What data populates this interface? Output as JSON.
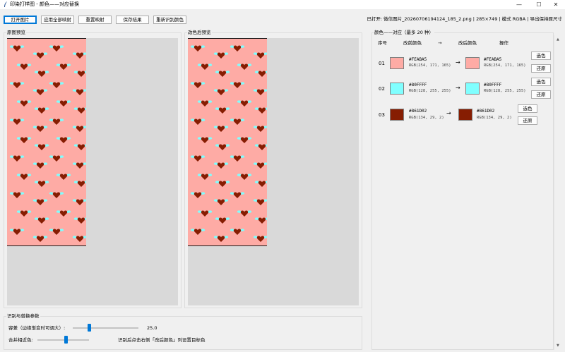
{
  "window": {
    "title": "印染打样图 - 颜色——对应替换",
    "minimize": "—",
    "maximize": "☐",
    "close": "✕"
  },
  "toolbar": {
    "open": "打开图片",
    "apply_all": "应用全部映射",
    "reset_map": "重置映射",
    "save": "保存结果",
    "redetect": "重新识别颜色",
    "file_info": "已打开: 微信图片_20260706194124_185_2.png  |  285×749  |  模式 RGBA  |  导出保持原尺寸"
  },
  "preview": {
    "original_title": "原图预览",
    "modified_title": "改色后预览"
  },
  "mapping": {
    "title": "颜色——对应（最多 20 种）",
    "headers": {
      "index": "序号",
      "before": "改前颜色",
      "arrow": "→",
      "after": "改后颜色",
      "action": "操作"
    },
    "rows": [
      {
        "index": "01",
        "before_hex": "#FEABA5",
        "before_rgb": "RGB(254, 171, 165)",
        "after_hex": "#FEABA5",
        "after_rgb": "RGB(254, 171, 165)",
        "arrow": "→",
        "pick": "选色",
        "restore": "还原"
      },
      {
        "index": "02",
        "before_hex": "#80FFFF",
        "before_rgb": "RGB(128, 255, 255)",
        "after_hex": "#80FFFF",
        "after_rgb": "RGB(128, 255, 255)",
        "arrow": "→",
        "pick": "选色",
        "restore": "还原"
      },
      {
        "index": "03",
        "before_hex": "#861D02",
        "before_rgb": "RGB(134, 29, 2)",
        "after_hex": "#861D02",
        "after_rgb": "RGB(134, 29, 2)",
        "arrow": "→",
        "pick": "选色",
        "restore": "还原"
      }
    ]
  },
  "params": {
    "title": "识别与替换参数",
    "tolerance_label": "容差（边缘渐变时可调大）:",
    "tolerance_value": "25.0",
    "tolerance_fraction": 0.25,
    "merge_label": "合并相近色:",
    "merge_fraction": 0.55,
    "hint": "识别后点击右侧「改后颜色」列设置目标色"
  },
  "colors": {
    "accent": "#0078d7",
    "fabric": "#feaba5",
    "wing": "#80ffff",
    "heart": "#861d02"
  }
}
